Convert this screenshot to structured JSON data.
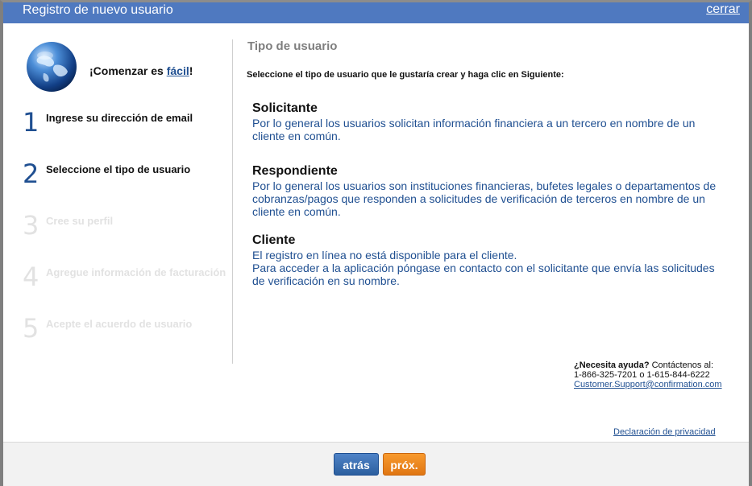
{
  "window": {
    "title": "Registro de nuevo usuario",
    "close_label": "cerrar"
  },
  "sidebar": {
    "tagline_prefix": "¡Comenzar es ",
    "tagline_link": "fácil",
    "tagline_suffix": "!",
    "steps": [
      {
        "number": "1",
        "label": "Ingrese su dirección de email",
        "state": "active"
      },
      {
        "number": "2",
        "label": "Seleccione el tipo de usuario",
        "state": "active"
      },
      {
        "number": "3",
        "label": "Cree su perfil",
        "state": "inactive"
      },
      {
        "number": "4",
        "label": "Agregue información de facturación",
        "state": "inactive"
      },
      {
        "number": "5",
        "label": "Acepte el acuerdo de usuario",
        "state": "inactive"
      }
    ]
  },
  "main": {
    "section_title": "Tipo de usuario",
    "instruction": "Seleccione el tipo de usuario que le gustaría crear y haga clic en Siguiente:",
    "options": [
      {
        "title": "Solicitante",
        "description": "Por lo general los usuarios solicitan información financiera a un tercero en nombre de un cliente en común."
      },
      {
        "title": "Respondiente",
        "description": "Por lo general los usuarios son instituciones financieras, bufetes legales o departamentos de cobranzas/pagos que responden a solicitudes de verificación de terceros en nombre de un cliente en común."
      },
      {
        "title": "Cliente",
        "description_line1": "El registro en línea no está disponible para el cliente.",
        "description_line2": "Para acceder a la aplicación póngase en contacto con el solicitante que envía las solicitudes de verificación en su nombre."
      }
    ]
  },
  "help": {
    "question": "¿Necesita ayuda?",
    "contact_text": " Contáctenos al:",
    "phones": "1-866-325-7201 o 1-615-844-6222",
    "email": "Customer.Support@confirmation.com"
  },
  "privacy_link": "Declaración de privacidad",
  "footer": {
    "back_label": "atrás",
    "next_label": "próx."
  },
  "colors": {
    "titlebar": "#4f79c0",
    "accent_blue": "#1f4f91",
    "next_orange": "#f08a20",
    "inactive_step": "#e2e2e2"
  },
  "icons": {
    "globe": "globe-icon"
  }
}
